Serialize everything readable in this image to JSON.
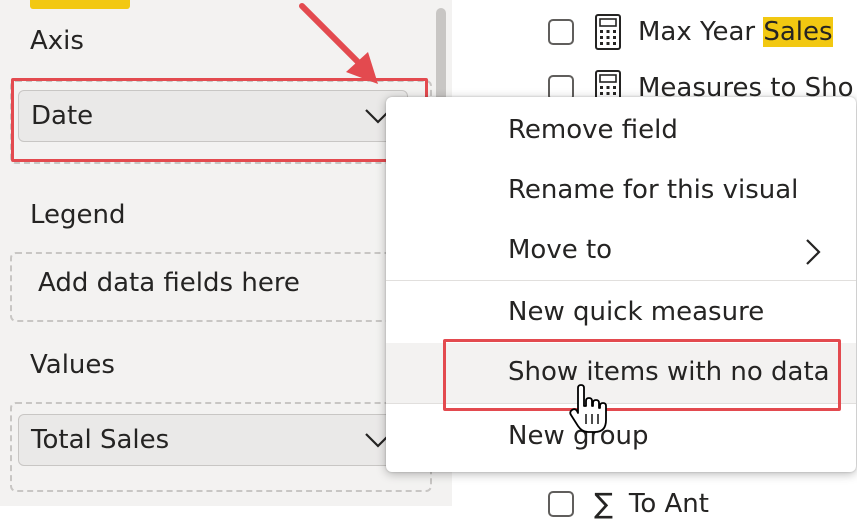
{
  "fields_pane": {
    "axis": {
      "label": "Axis",
      "field": "Date"
    },
    "legend": {
      "label": "Legend",
      "placeholder": "Add data fields here"
    },
    "values": {
      "label": "Values",
      "field": "Total Sales"
    }
  },
  "field_list": {
    "items": [
      {
        "label_prefix": "Max Year ",
        "label_highlight": "Sales",
        "icon": "calculator-icon"
      },
      {
        "label_prefix": "Measures to Sho",
        "label_highlight": "",
        "icon": "calculator-icon"
      },
      {
        "label_prefix": "To Ant",
        "label_highlight": "",
        "icon": "sigma-icon"
      }
    ]
  },
  "context_menu": {
    "items": [
      {
        "label": "Remove field"
      },
      {
        "label": "Rename for this visual"
      },
      {
        "label": "Move to",
        "has_submenu": true
      },
      {
        "label": "New quick measure"
      },
      {
        "label": "Show items with no data",
        "hovered": true
      },
      {
        "label": "New group"
      }
    ]
  },
  "colors": {
    "annotation_red": "#e34a4f",
    "search_highlight": "#f2c811",
    "pane_background": "#f3f2f1"
  }
}
